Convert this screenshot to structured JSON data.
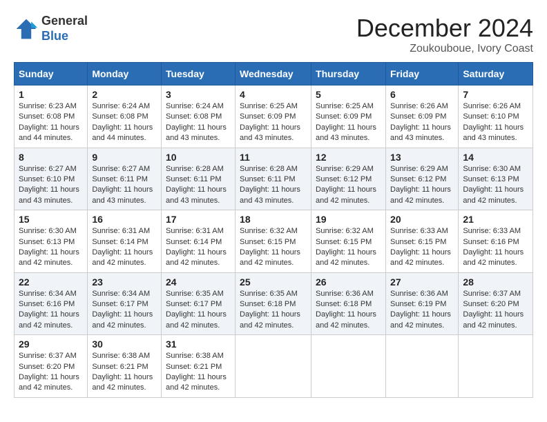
{
  "header": {
    "logo_line1": "General",
    "logo_line2": "Blue",
    "month_title": "December 2024",
    "location": "Zoukouboue, Ivory Coast"
  },
  "weekdays": [
    "Sunday",
    "Monday",
    "Tuesday",
    "Wednesday",
    "Thursday",
    "Friday",
    "Saturday"
  ],
  "weeks": [
    [
      {
        "day": "1",
        "sunrise": "6:23 AM",
        "sunset": "6:08 PM",
        "daylight": "11 hours and 44 minutes."
      },
      {
        "day": "2",
        "sunrise": "6:24 AM",
        "sunset": "6:08 PM",
        "daylight": "11 hours and 44 minutes."
      },
      {
        "day": "3",
        "sunrise": "6:24 AM",
        "sunset": "6:08 PM",
        "daylight": "11 hours and 43 minutes."
      },
      {
        "day": "4",
        "sunrise": "6:25 AM",
        "sunset": "6:09 PM",
        "daylight": "11 hours and 43 minutes."
      },
      {
        "day": "5",
        "sunrise": "6:25 AM",
        "sunset": "6:09 PM",
        "daylight": "11 hours and 43 minutes."
      },
      {
        "day": "6",
        "sunrise": "6:26 AM",
        "sunset": "6:09 PM",
        "daylight": "11 hours and 43 minutes."
      },
      {
        "day": "7",
        "sunrise": "6:26 AM",
        "sunset": "6:10 PM",
        "daylight": "11 hours and 43 minutes."
      }
    ],
    [
      {
        "day": "8",
        "sunrise": "6:27 AM",
        "sunset": "6:10 PM",
        "daylight": "11 hours and 43 minutes."
      },
      {
        "day": "9",
        "sunrise": "6:27 AM",
        "sunset": "6:11 PM",
        "daylight": "11 hours and 43 minutes."
      },
      {
        "day": "10",
        "sunrise": "6:28 AM",
        "sunset": "6:11 PM",
        "daylight": "11 hours and 43 minutes."
      },
      {
        "day": "11",
        "sunrise": "6:28 AM",
        "sunset": "6:11 PM",
        "daylight": "11 hours and 43 minutes."
      },
      {
        "day": "12",
        "sunrise": "6:29 AM",
        "sunset": "6:12 PM",
        "daylight": "11 hours and 42 minutes."
      },
      {
        "day": "13",
        "sunrise": "6:29 AM",
        "sunset": "6:12 PM",
        "daylight": "11 hours and 42 minutes."
      },
      {
        "day": "14",
        "sunrise": "6:30 AM",
        "sunset": "6:13 PM",
        "daylight": "11 hours and 42 minutes."
      }
    ],
    [
      {
        "day": "15",
        "sunrise": "6:30 AM",
        "sunset": "6:13 PM",
        "daylight": "11 hours and 42 minutes."
      },
      {
        "day": "16",
        "sunrise": "6:31 AM",
        "sunset": "6:14 PM",
        "daylight": "11 hours and 42 minutes."
      },
      {
        "day": "17",
        "sunrise": "6:31 AM",
        "sunset": "6:14 PM",
        "daylight": "11 hours and 42 minutes."
      },
      {
        "day": "18",
        "sunrise": "6:32 AM",
        "sunset": "6:15 PM",
        "daylight": "11 hours and 42 minutes."
      },
      {
        "day": "19",
        "sunrise": "6:32 AM",
        "sunset": "6:15 PM",
        "daylight": "11 hours and 42 minutes."
      },
      {
        "day": "20",
        "sunrise": "6:33 AM",
        "sunset": "6:15 PM",
        "daylight": "11 hours and 42 minutes."
      },
      {
        "day": "21",
        "sunrise": "6:33 AM",
        "sunset": "6:16 PM",
        "daylight": "11 hours and 42 minutes."
      }
    ],
    [
      {
        "day": "22",
        "sunrise": "6:34 AM",
        "sunset": "6:16 PM",
        "daylight": "11 hours and 42 minutes."
      },
      {
        "day": "23",
        "sunrise": "6:34 AM",
        "sunset": "6:17 PM",
        "daylight": "11 hours and 42 minutes."
      },
      {
        "day": "24",
        "sunrise": "6:35 AM",
        "sunset": "6:17 PM",
        "daylight": "11 hours and 42 minutes."
      },
      {
        "day": "25",
        "sunrise": "6:35 AM",
        "sunset": "6:18 PM",
        "daylight": "11 hours and 42 minutes."
      },
      {
        "day": "26",
        "sunrise": "6:36 AM",
        "sunset": "6:18 PM",
        "daylight": "11 hours and 42 minutes."
      },
      {
        "day": "27",
        "sunrise": "6:36 AM",
        "sunset": "6:19 PM",
        "daylight": "11 hours and 42 minutes."
      },
      {
        "day": "28",
        "sunrise": "6:37 AM",
        "sunset": "6:20 PM",
        "daylight": "11 hours and 42 minutes."
      }
    ],
    [
      {
        "day": "29",
        "sunrise": "6:37 AM",
        "sunset": "6:20 PM",
        "daylight": "11 hours and 42 minutes."
      },
      {
        "day": "30",
        "sunrise": "6:38 AM",
        "sunset": "6:21 PM",
        "daylight": "11 hours and 42 minutes."
      },
      {
        "day": "31",
        "sunrise": "6:38 AM",
        "sunset": "6:21 PM",
        "daylight": "11 hours and 42 minutes."
      },
      null,
      null,
      null,
      null
    ]
  ]
}
